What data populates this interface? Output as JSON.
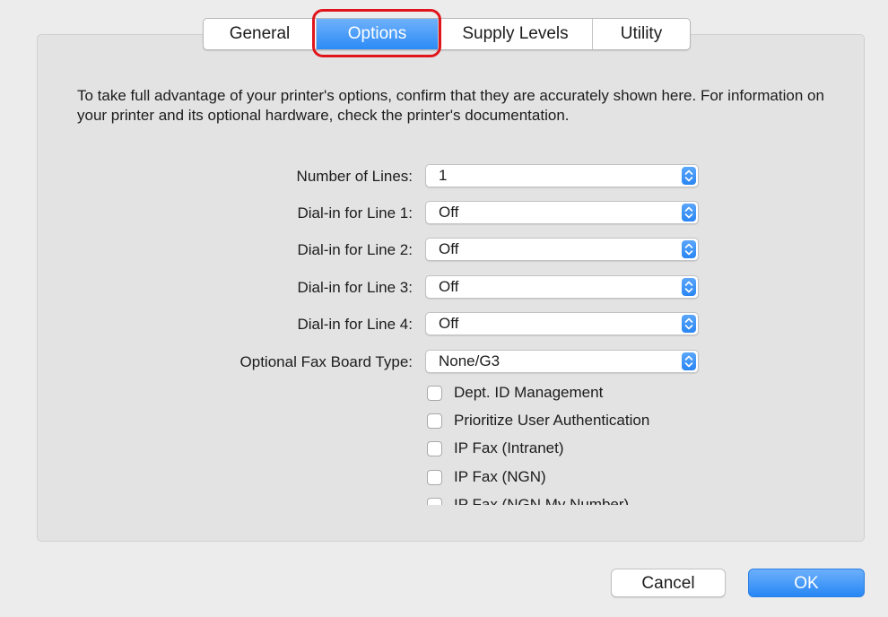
{
  "tabs": {
    "general": "General",
    "options": "Options",
    "supply_levels": "Supply Levels",
    "utility": "Utility",
    "active": "Options"
  },
  "description": "To take full advantage of your printer's options, confirm that they are accurately shown here. For information on your printer and its optional hardware, check the printer's documentation.",
  "fields": [
    {
      "label": "Number of Lines:",
      "value": "1"
    },
    {
      "label": "Dial-in for Line 1:",
      "value": "Off"
    },
    {
      "label": "Dial-in for Line 2:",
      "value": "Off"
    },
    {
      "label": "Dial-in for Line 3:",
      "value": "Off"
    },
    {
      "label": "Dial-in for Line 4:",
      "value": "Off"
    },
    {
      "label": "Optional Fax Board Type:",
      "value": "None/G3"
    }
  ],
  "checkboxes": [
    {
      "label": "Dept. ID Management",
      "checked": false
    },
    {
      "label": "Prioritize User Authentication",
      "checked": false
    },
    {
      "label": "IP Fax (Intranet)",
      "checked": false
    },
    {
      "label": "IP Fax (NGN)",
      "checked": false
    },
    {
      "label": "IP Fax (NGN My Number)",
      "checked": false
    }
  ],
  "buttons": {
    "cancel": "Cancel",
    "ok": "OK"
  },
  "colors": {
    "accent": "#2b8bf6",
    "highlight_ring": "#e0151b"
  }
}
